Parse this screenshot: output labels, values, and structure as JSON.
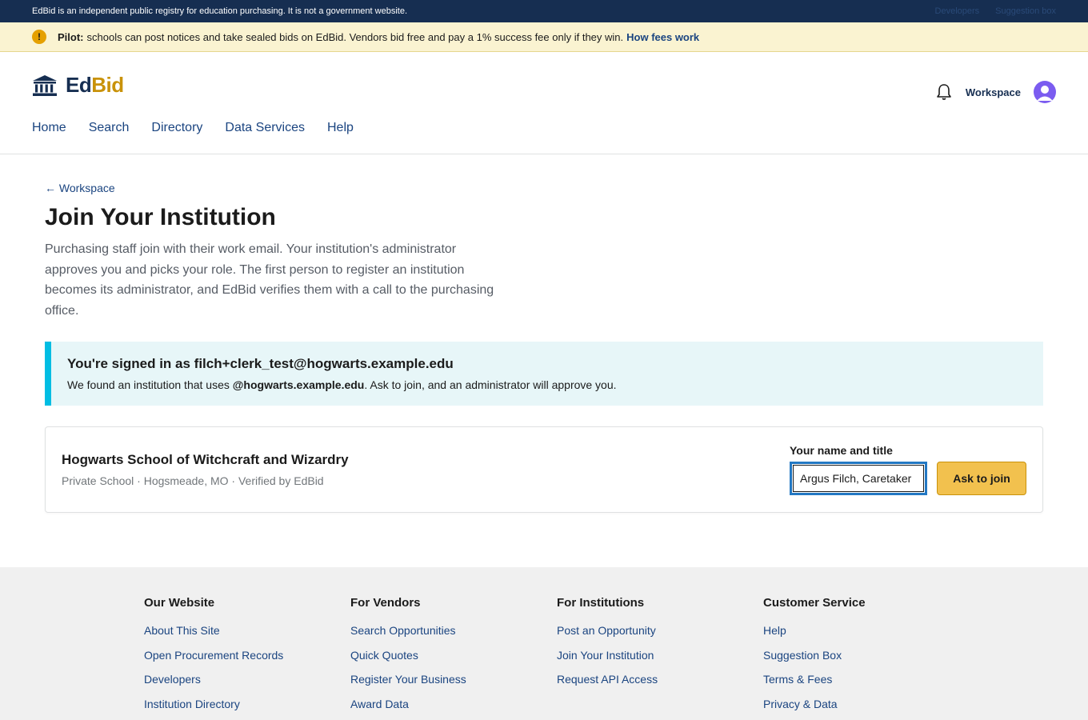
{
  "topbar": {
    "notice": "EdBid is an independent public registry for education purchasing. It is not a government website.",
    "links": [
      "Developers",
      "Suggestion box"
    ]
  },
  "pilot": {
    "icon": "warning-icon",
    "label": "Pilot:",
    "text": "schools can post notices and take sealed bids on EdBid. Vendors bid free and pay a 1% success fee only if they win.",
    "link": "How fees work"
  },
  "header": {
    "logo_ed": "Ed",
    "logo_bid": "Bid",
    "workspace": "Workspace",
    "nav": [
      "Home",
      "Search",
      "Directory",
      "Data Services",
      "Help"
    ]
  },
  "main": {
    "back": "← Workspace",
    "title": "Join Your Institution",
    "intro": "Purchasing staff join with their work email. Your institution's administrator approves you and picks your role. The first person to register an institution becomes its administrator, and EdBid verifies them with a call to the purchasing office.",
    "alert": {
      "heading": "You're signed in as filch+clerk_test@hogwarts.example.edu",
      "body_pre": "We found an institution that uses ",
      "body_domain": "@hogwarts.example.edu",
      "body_post": ". Ask to join, and an administrator will approve you."
    },
    "institution": {
      "name": "Hogwarts School of Witchcraft and Wizardry",
      "meta": "Private School · Hogsmeade, MO · Verified by EdBid",
      "field_label": "Your name and title",
      "field_value": "Argus Filch, Caretaker",
      "button": "Ask to join"
    }
  },
  "footer": {
    "columns": [
      {
        "heading": "Our Website",
        "links": [
          "About This Site",
          "Open Procurement Records",
          "Developers",
          "Institution Directory"
        ]
      },
      {
        "heading": "For Vendors",
        "links": [
          "Search Opportunities",
          "Quick Quotes",
          "Register Your Business",
          "Award Data"
        ]
      },
      {
        "heading": "For Institutions",
        "links": [
          "Post an Opportunity",
          "Join Your Institution",
          "Request API Access"
        ]
      },
      {
        "heading": "Customer Service",
        "links": [
          "Help",
          "Suggestion Box",
          "Terms & Fees",
          "Privacy & Data"
        ]
      }
    ]
  },
  "colors": {
    "navy": "#162e51",
    "link": "#1a4480",
    "gold": "#c9920a",
    "button": "#f2c14e",
    "alert_bg": "#e7f6f8",
    "alert_border": "#00bde3"
  }
}
